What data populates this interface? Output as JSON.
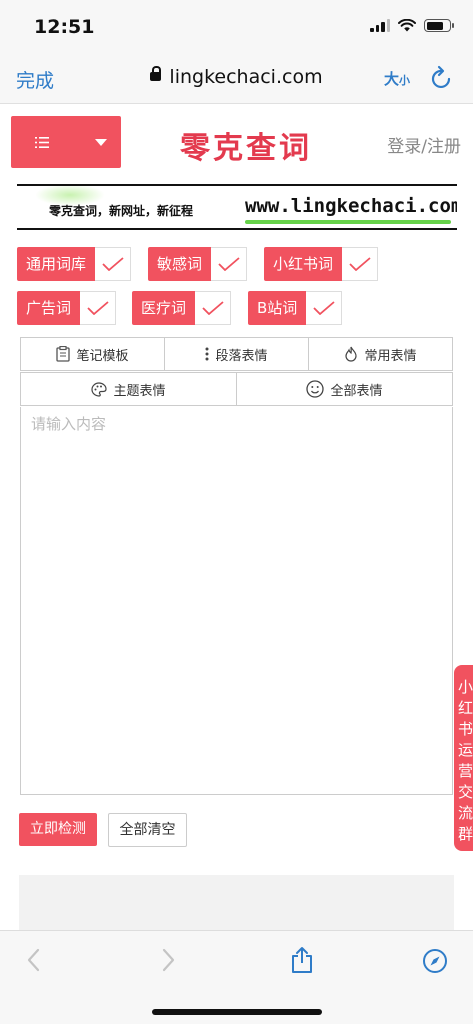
{
  "status_bar": {
    "time": "12:51"
  },
  "browser": {
    "done_label": "完成",
    "url": "lingkechaci.com",
    "text_size_big": "大",
    "text_size_small": "小"
  },
  "header": {
    "logo": "零克查词",
    "login": "登录/注册"
  },
  "banner": {
    "slogan": "零克查词，新网址，新征程",
    "site": "www.lingkechaci.com"
  },
  "word_banks": [
    {
      "label": "通用词库",
      "checked": true
    },
    {
      "label": "敏感词",
      "checked": true
    },
    {
      "label": "小红书词",
      "checked": true
    },
    {
      "label": "广告词",
      "checked": true
    },
    {
      "label": "医疗词",
      "checked": true
    },
    {
      "label": "B站词",
      "checked": true
    }
  ],
  "toolbar": {
    "note_template": "笔记模板",
    "paragraph_emoji": "段落表情",
    "common_emoji": "常用表情",
    "theme_emoji": "主题表情",
    "all_emoji": "全部表情"
  },
  "editor": {
    "placeholder": "请输入内容"
  },
  "actions": {
    "check_now": "立即检测",
    "clear_all": "全部清空"
  },
  "side_tab": {
    "text": "小红书运营交流群"
  },
  "colors": {
    "accent": "#f1525f",
    "ios_blue": "#2f7cc8",
    "logo_red": "#e33a4e"
  }
}
